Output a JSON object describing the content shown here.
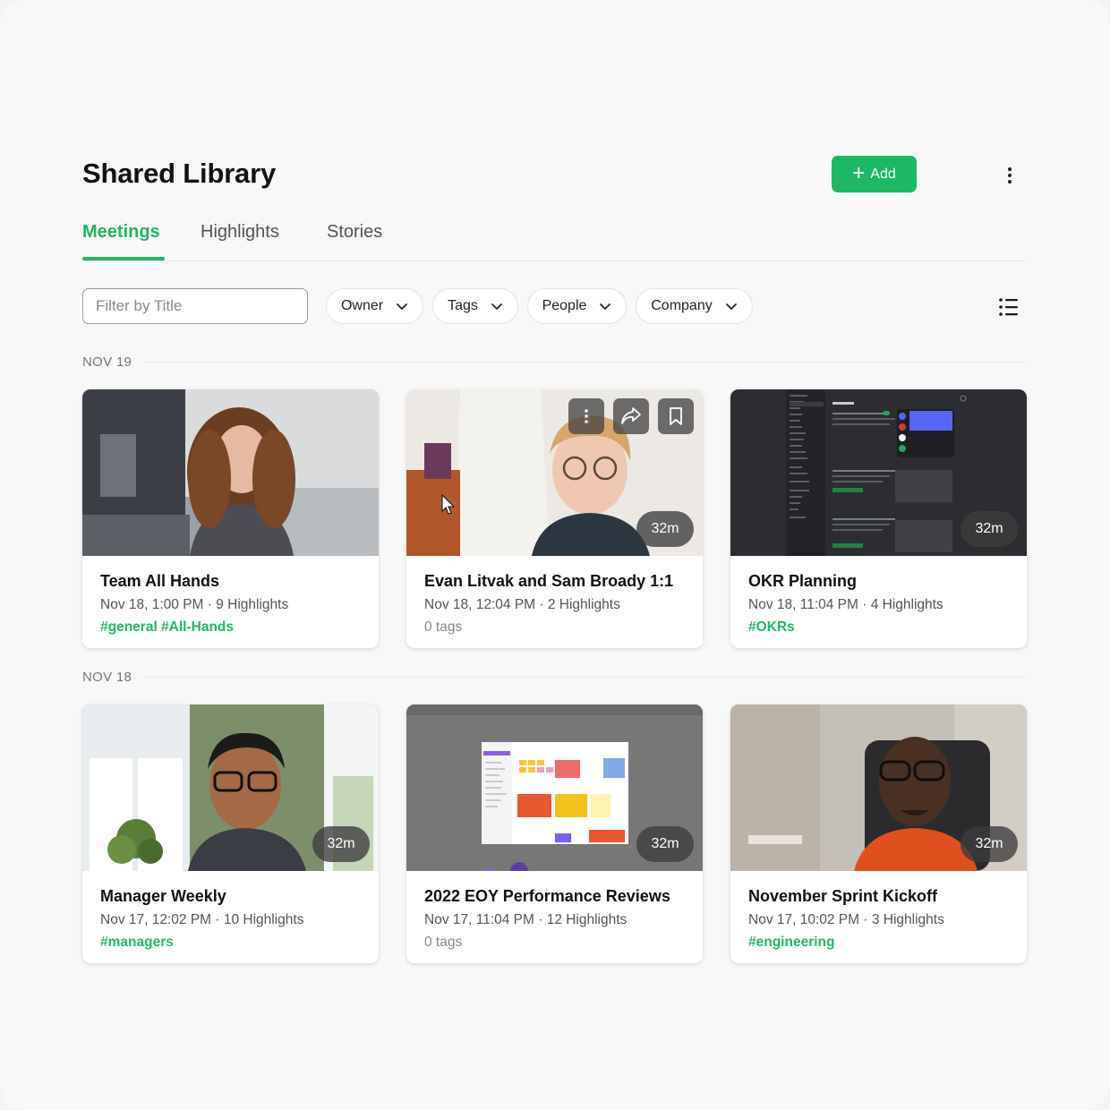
{
  "header": {
    "title": "Shared Library",
    "add_label": "Add"
  },
  "tabs": [
    {
      "label": "Meetings",
      "active": true
    },
    {
      "label": "Highlights",
      "active": false
    },
    {
      "label": "Stories",
      "active": false
    }
  ],
  "filters": {
    "title_placeholder": "Filter by Title",
    "dropdowns": [
      "Owner",
      "Tags",
      "People",
      "Company"
    ]
  },
  "colors": {
    "accent": "#1db866",
    "text": "#111111",
    "muted": "#555555"
  },
  "groups": [
    {
      "date": "NOV 19",
      "cards": [
        {
          "title": "Team All Hands",
          "meta": "Nov 18, 1:00 PM · 9 Highlights",
          "tags": "#general #All-Hands",
          "duration": "",
          "thumb": "woman-curly-hair-video"
        },
        {
          "title": "Evan Litvak and Sam Broady 1:1",
          "meta": "Nov 18, 12:04 PM · 2 Highlights",
          "tags": "0 tags",
          "duration": "32m",
          "thumb": "person-with-glasses-video"
        },
        {
          "title": "OKR Planning",
          "meta": "Nov 18, 11:04 PM · 4 Highlights",
          "tags": "#OKRs",
          "duration": "32m",
          "thumb": "dark-settings-screen-share"
        }
      ]
    },
    {
      "date": "NOV 18",
      "cards": [
        {
          "title": "Manager Weekly",
          "meta": "Nov 17, 12:02 PM · 10 Highlights",
          "tags": "#managers",
          "duration": "32m",
          "thumb": "man-glasses-window-video"
        },
        {
          "title": "2022 EOY Performance Reviews",
          "meta": "Nov 17, 11:04 PM · 12 Highlights",
          "tags": "0 tags",
          "duration": "32m",
          "thumb": "whiteboard-screen-share"
        },
        {
          "title": "November Sprint Kickoff",
          "meta": "Nov 17, 10:02 PM · 3 Highlights",
          "tags": "#engineering",
          "duration": "32m",
          "thumb": "man-orange-shirt-video"
        }
      ]
    }
  ]
}
